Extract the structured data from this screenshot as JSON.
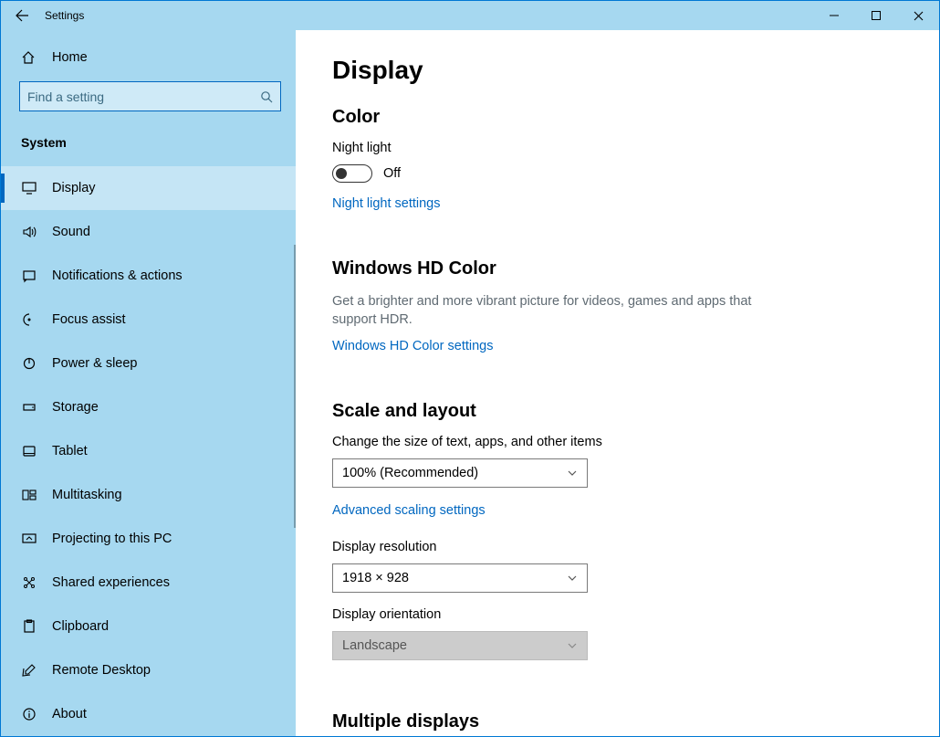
{
  "window": {
    "title": "Settings"
  },
  "sidebar": {
    "home": "Home",
    "search_placeholder": "Find a setting",
    "group": "System",
    "items": [
      {
        "label": "Display",
        "icon": "display-icon",
        "active": true
      },
      {
        "label": "Sound",
        "icon": "sound-icon"
      },
      {
        "label": "Notifications & actions",
        "icon": "notifications-icon"
      },
      {
        "label": "Focus assist",
        "icon": "focus-assist-icon"
      },
      {
        "label": "Power & sleep",
        "icon": "power-icon"
      },
      {
        "label": "Storage",
        "icon": "storage-icon"
      },
      {
        "label": "Tablet",
        "icon": "tablet-icon"
      },
      {
        "label": "Multitasking",
        "icon": "multitasking-icon"
      },
      {
        "label": "Projecting to this PC",
        "icon": "projecting-icon"
      },
      {
        "label": "Shared experiences",
        "icon": "shared-icon"
      },
      {
        "label": "Clipboard",
        "icon": "clipboard-icon"
      },
      {
        "label": "Remote Desktop",
        "icon": "remote-icon"
      },
      {
        "label": "About",
        "icon": "about-icon"
      }
    ]
  },
  "content": {
    "title": "Display",
    "color": {
      "heading": "Color",
      "night_light_label": "Night light",
      "night_light_state": "Off",
      "night_light_link": "Night light settings"
    },
    "hdcolor": {
      "heading": "Windows HD Color",
      "desc": "Get a brighter and more vibrant picture for videos, games and apps that support HDR.",
      "link": "Windows HD Color settings"
    },
    "scale": {
      "heading": "Scale and layout",
      "scale_label": "Change the size of text, apps, and other items",
      "scale_value": "100% (Recommended)",
      "adv_link": "Advanced scaling settings",
      "res_label": "Display resolution",
      "res_value": "1918 × 928",
      "orient_label": "Display orientation",
      "orient_value": "Landscape"
    },
    "multiple": {
      "heading": "Multiple displays"
    }
  }
}
